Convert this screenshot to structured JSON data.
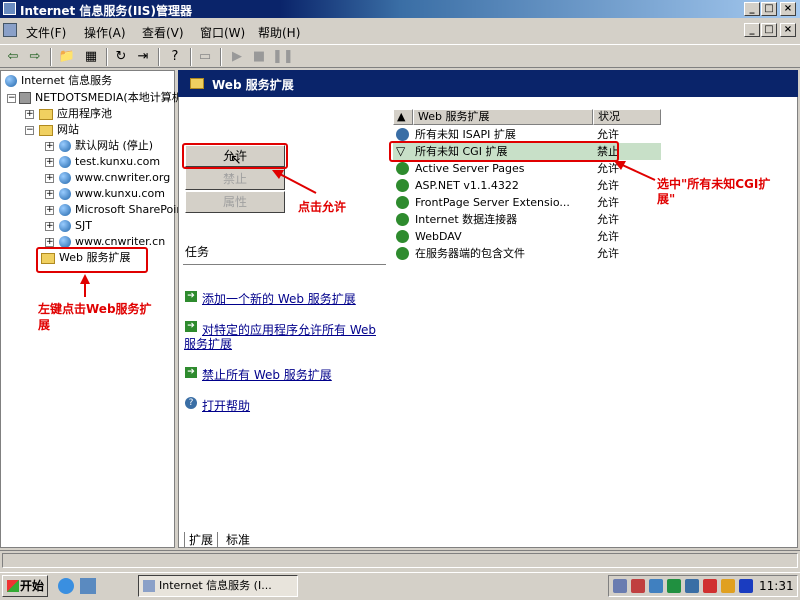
{
  "window": {
    "title": "Internet 信息服务(IIS)管理器"
  },
  "menu": [
    {
      "label": "文件(F)"
    },
    {
      "label": "操作(A)"
    },
    {
      "label": "查看(V)"
    },
    {
      "label": "窗口(W)"
    },
    {
      "label": "帮助(H)"
    }
  ],
  "tree": {
    "root": "Internet 信息服务",
    "server": "NETDOTSMEDIA(本地计算机)",
    "app_pools": "应用程序池",
    "sites": "网站",
    "site_items": [
      "默认网站 (停止)",
      "test.kunxu.com",
      "www.cnwriter.org",
      "www.kunxu.com",
      "Microsoft SharePoint",
      "SJT",
      "www.cnwriter.cn"
    ],
    "web_ext": "Web 服务扩展"
  },
  "right": {
    "header": "Web 服务扩展",
    "buttons": {
      "allow": "允许",
      "deny": "禁止",
      "props": "属性"
    },
    "tasks_title": "任务",
    "tasks": [
      "添加一个新的 Web 服务扩展",
      "对特定的应用程序允许所有 Web",
      "服务扩展",
      "禁止所有 Web 服务扩展",
      "打开帮助"
    ],
    "columns": {
      "name": "Web 服务扩展",
      "status": "状况"
    },
    "rows": [
      {
        "name": "所有未知 ISAPI 扩展",
        "status": "允许"
      },
      {
        "name": "所有未知 CGI 扩展",
        "status": "禁止"
      },
      {
        "name": "Active Server Pages",
        "status": "允许"
      },
      {
        "name": "ASP.NET v1.1.4322",
        "status": "允许"
      },
      {
        "name": "FrontPage Server Extensio...",
        "status": "允许"
      },
      {
        "name": "Internet 数据连接器",
        "status": "允许"
      },
      {
        "name": "WebDAV",
        "status": "允许"
      },
      {
        "name": "在服务器端的包含文件",
        "status": "允许"
      }
    ],
    "tabs": [
      "扩展",
      "标准"
    ]
  },
  "annotations": {
    "click_allow": "点击允许",
    "select_cgi_1": "选中\"所有未知CGI扩",
    "select_cgi_2": "展\"",
    "left_click_1": "左键点击Web服务扩",
    "left_click_2": "展"
  },
  "taskbar": {
    "start": "开始",
    "task_item": "Internet 信息服务 (I...",
    "clock": "11:31"
  },
  "colors": {
    "annotation": "#e00000",
    "title_bar": "#0a246a"
  }
}
